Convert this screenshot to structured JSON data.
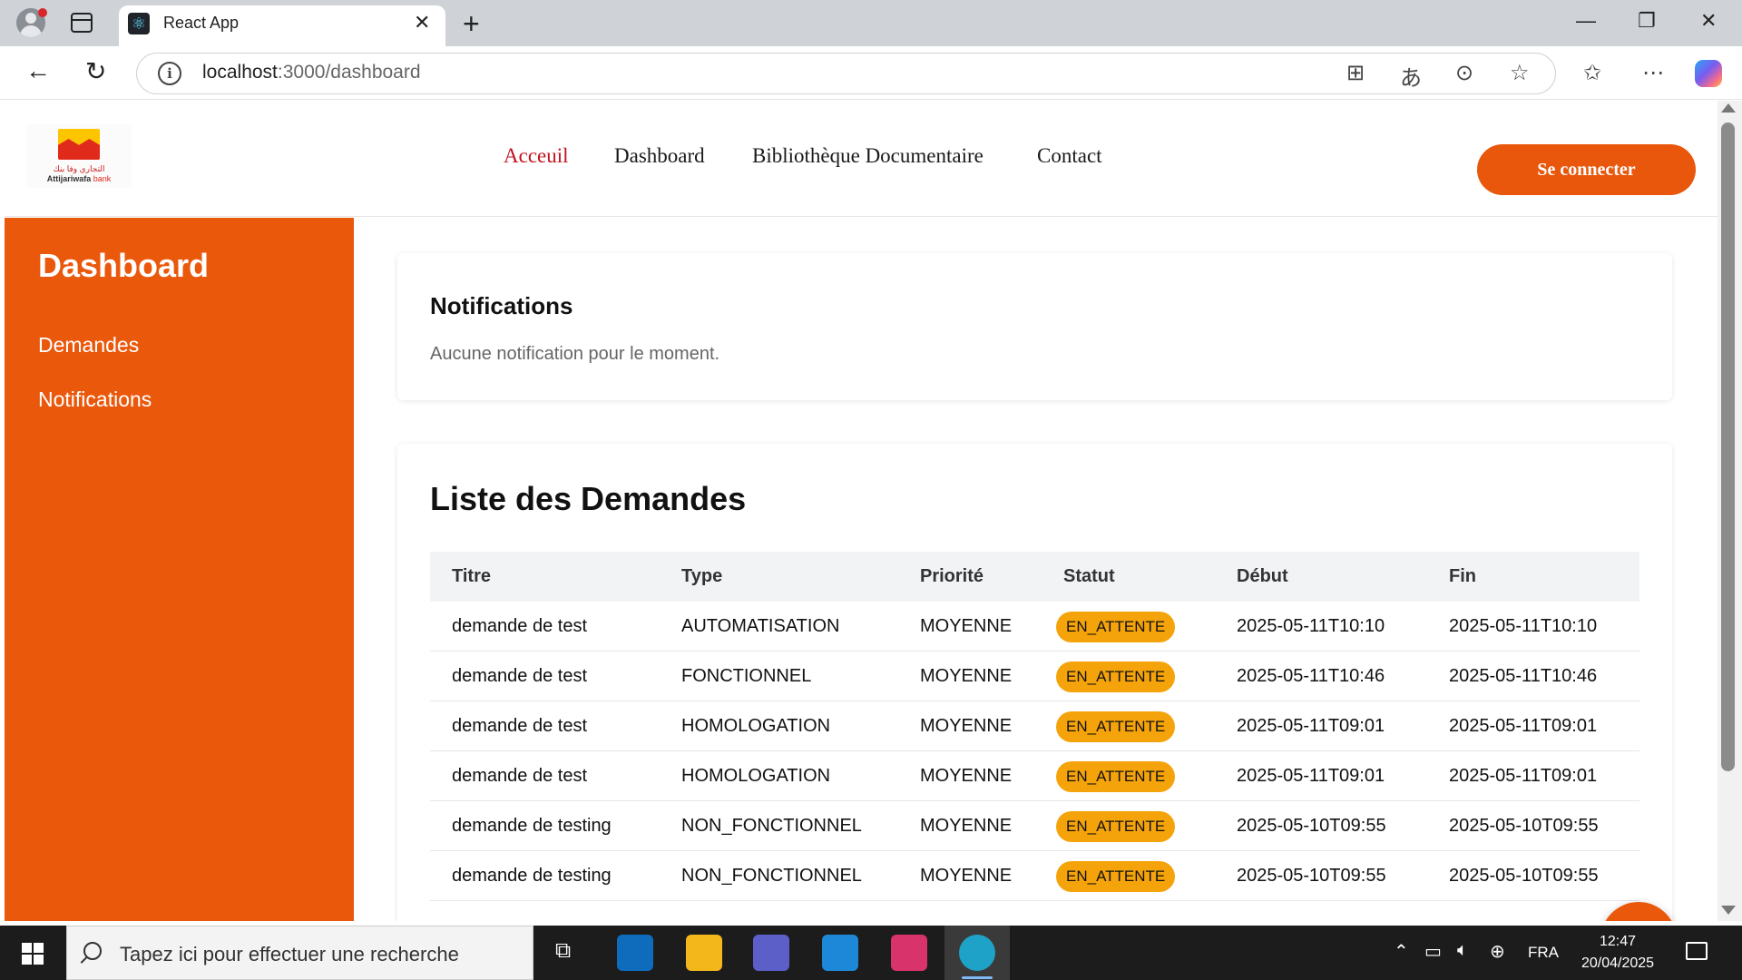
{
  "browser": {
    "tab_title": "React App",
    "url_host": "localhost",
    "url_path": ":3000/dashboard"
  },
  "header": {
    "logo_text_latin": "Attijariwafa",
    "logo_text_bank": "bank",
    "logo_text_arabic": "التجاري وفا بنك",
    "nav": [
      "Acceuil",
      "Dashboard",
      "Bibliothèque Documentaire",
      "Contact"
    ],
    "login_label": "Se connecter"
  },
  "sidebar": {
    "title": "Dashboard",
    "items": [
      "Demandes",
      "Notifications"
    ]
  },
  "notifications": {
    "title": "Notifications",
    "empty_text": "Aucune notification pour le moment."
  },
  "demandes": {
    "title": "Liste des Demandes",
    "columns": [
      "Titre",
      "Type",
      "Priorité",
      "Statut",
      "Début",
      "Fin"
    ],
    "rows": [
      [
        "demande de test",
        "AUTOMATISATION",
        "MOYENNE",
        "EN_ATTENTE",
        "2025-05-11T10:10",
        "2025-05-11T10:10"
      ],
      [
        "demande de test",
        "FONCTIONNEL",
        "MOYENNE",
        "EN_ATTENTE",
        "2025-05-11T10:46",
        "2025-05-11T10:46"
      ],
      [
        "demande de test",
        "HOMOLOGATION",
        "MOYENNE",
        "EN_ATTENTE",
        "2025-05-11T09:01",
        "2025-05-11T09:01"
      ],
      [
        "demande de test",
        "HOMOLOGATION",
        "MOYENNE",
        "EN_ATTENTE",
        "2025-05-11T09:01",
        "2025-05-11T09:01"
      ],
      [
        "demande de testing",
        "NON_FONCTIONNEL",
        "MOYENNE",
        "EN_ATTENTE",
        "2025-05-10T09:55",
        "2025-05-10T09:55"
      ],
      [
        "demande de testing",
        "NON_FONCTIONNEL",
        "MOYENNE",
        "EN_ATTENTE",
        "2025-05-10T09:55",
        "2025-05-10T09:55"
      ]
    ]
  },
  "taskbar": {
    "search_placeholder": "Tapez ici pour effectuer une recherche",
    "language": "FRA",
    "time": "12:47",
    "date": "20/04/2025"
  },
  "colors": {
    "brand_orange": "#ea580c",
    "active_nav_red": "#c0131e",
    "status_badge": "#f5a30b"
  }
}
